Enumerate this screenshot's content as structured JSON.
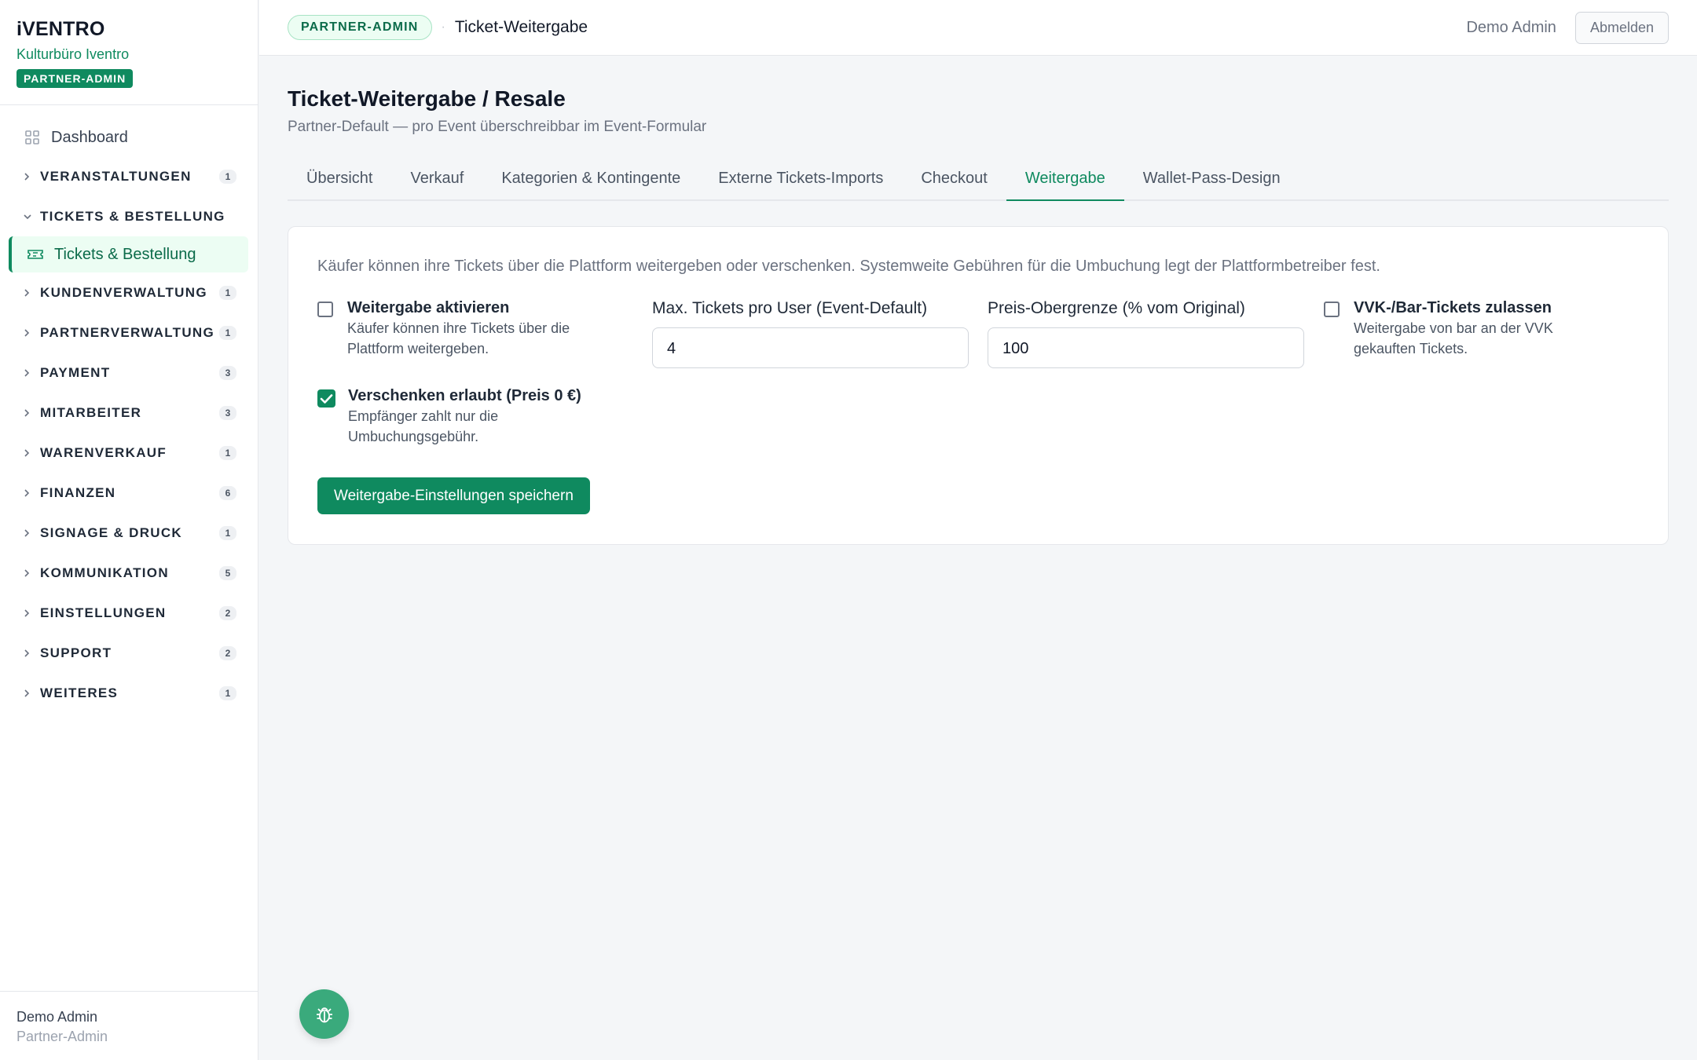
{
  "brand": {
    "logo": "iVENTRO",
    "org": "Kulturbüro Iventro",
    "role_badge": "PARTNER-ADMIN"
  },
  "sidebar": {
    "dashboard": "Dashboard",
    "groups": [
      {
        "label": "VERANSTALTUNGEN",
        "count": "1"
      },
      {
        "label": "TICKETS & BESTELLUNG",
        "expanded": true
      },
      {
        "label": "KUNDENVERWALTUNG",
        "count": "1"
      },
      {
        "label": "PARTNERVERWALTUNG",
        "count": "1"
      },
      {
        "label": "PAYMENT",
        "count": "3"
      },
      {
        "label": "MITARBEITER",
        "count": "3"
      },
      {
        "label": "WARENVERKAUF",
        "count": "1"
      },
      {
        "label": "FINANZEN",
        "count": "6"
      },
      {
        "label": "SIGNAGE & DRUCK",
        "count": "1"
      },
      {
        "label": "KOMMUNIKATION",
        "count": "5"
      },
      {
        "label": "EINSTELLUNGEN",
        "count": "2"
      },
      {
        "label": "SUPPORT",
        "count": "2"
      },
      {
        "label": "WEITERES",
        "count": "1"
      }
    ],
    "active_item": "Tickets & Bestellung",
    "footer": {
      "name": "Demo Admin",
      "role": "Partner-Admin"
    }
  },
  "topbar": {
    "role_pill": "PARTNER-ADMIN",
    "crumb": "Ticket-Weitergabe",
    "user": "Demo Admin",
    "logout": "Abmelden"
  },
  "page": {
    "title": "Ticket-Weitergabe / Resale",
    "subtitle": "Partner-Default — pro Event überschreibbar im Event-Formular",
    "tabs": [
      {
        "label": "Übersicht"
      },
      {
        "label": "Verkauf"
      },
      {
        "label": "Kategorien & Kontingente"
      },
      {
        "label": "Externe Tickets-Imports"
      },
      {
        "label": "Checkout"
      },
      {
        "label": "Weitergabe",
        "active": true
      },
      {
        "label": "Wallet-Pass-Design"
      }
    ]
  },
  "form": {
    "intro": "Käufer können ihre Tickets über die Plattform weitergeben oder verschenken. Systemweite Gebühren für die Umbuchung legt der Plattformbetreiber fest.",
    "enable": {
      "title": "Weitergabe aktivieren",
      "desc1": "Käufer können ihre Tickets über die",
      "desc2": "Plattform weitergeben.",
      "checked": false
    },
    "max_tickets": {
      "label": "Max. Tickets pro User (Event-Default)",
      "value": "4"
    },
    "price_cap": {
      "label": "Preis-Obergrenze (% vom Original)",
      "value": "100"
    },
    "vvk": {
      "title": "VVK-/Bar-Tickets zulassen",
      "desc1": "Weitergabe von bar an der VVK",
      "desc2": "gekauften Tickets.",
      "checked": false
    },
    "gift": {
      "title": "Verschenken erlaubt (Preis 0 €)",
      "desc1": "Empfänger zahlt nur die",
      "desc2": "Umbuchungsgebühr.",
      "checked": true
    },
    "save": "Weitergabe-Einstellungen speichern"
  },
  "icons": {
    "fab": "bug-icon",
    "dashboard": "grid-icon",
    "tickets": "ticket-icon"
  },
  "colors": {
    "accent": "#0f8a5f",
    "accent_light": "#ecfdf3",
    "fab": "#3aaa7c"
  }
}
